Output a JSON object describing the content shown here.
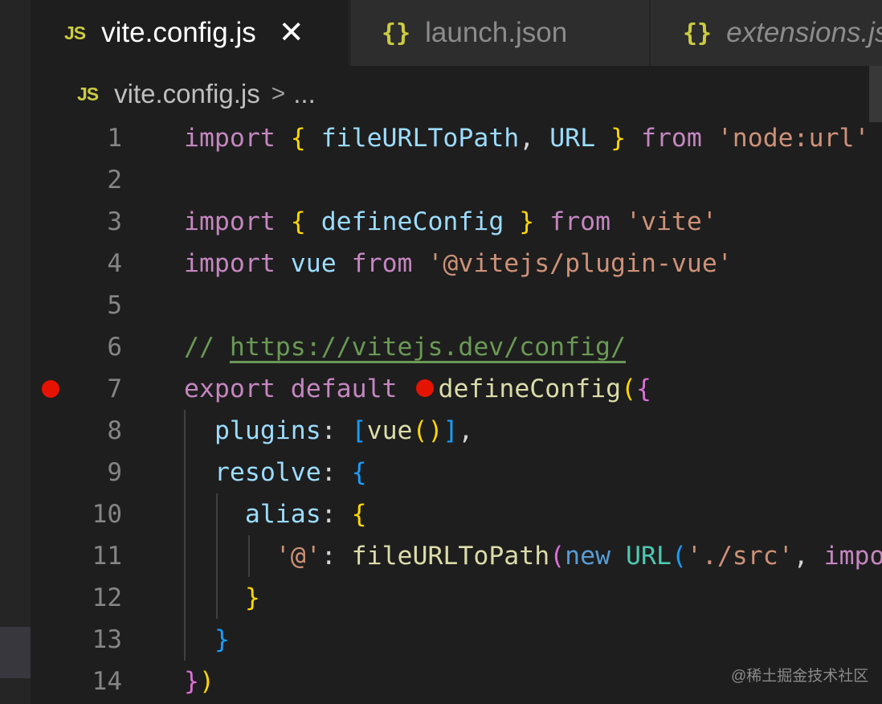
{
  "tabs": [
    {
      "badge": "JS",
      "label": "vite.config.js",
      "close": "✕"
    },
    {
      "badge": "{}",
      "label": "launch.json"
    },
    {
      "badge": "{}",
      "label": "extensions.json"
    }
  ],
  "breadcrumb": {
    "badge": "JS",
    "file": "vite.config.js",
    "separator": ">",
    "more": "..."
  },
  "breakpoint_color": "#e51400",
  "lines": [
    {
      "n": "1",
      "tokens": [
        {
          "t": "import",
          "c": "kw"
        },
        {
          "t": " ",
          "c": "p"
        },
        {
          "t": "{",
          "c": "b1"
        },
        {
          "t": " ",
          "c": "p"
        },
        {
          "t": "fileURLToPath",
          "c": "var"
        },
        {
          "t": ", ",
          "c": "p"
        },
        {
          "t": "URL",
          "c": "var"
        },
        {
          "t": " ",
          "c": "p"
        },
        {
          "t": "}",
          "c": "b1"
        },
        {
          "t": " ",
          "c": "p"
        },
        {
          "t": "from",
          "c": "kw"
        },
        {
          "t": " ",
          "c": "p"
        },
        {
          "t": "'node:url'",
          "c": "str"
        }
      ]
    },
    {
      "n": "2",
      "tokens": []
    },
    {
      "n": "3",
      "tokens": [
        {
          "t": "import",
          "c": "kw"
        },
        {
          "t": " ",
          "c": "p"
        },
        {
          "t": "{",
          "c": "b1"
        },
        {
          "t": " ",
          "c": "p"
        },
        {
          "t": "defineConfig",
          "c": "var"
        },
        {
          "t": " ",
          "c": "p"
        },
        {
          "t": "}",
          "c": "b1"
        },
        {
          "t": " ",
          "c": "p"
        },
        {
          "t": "from",
          "c": "kw"
        },
        {
          "t": " ",
          "c": "p"
        },
        {
          "t": "'vite'",
          "c": "str"
        }
      ]
    },
    {
      "n": "4",
      "tokens": [
        {
          "t": "import",
          "c": "kw"
        },
        {
          "t": " ",
          "c": "p"
        },
        {
          "t": "vue",
          "c": "var"
        },
        {
          "t": " ",
          "c": "p"
        },
        {
          "t": "from",
          "c": "kw"
        },
        {
          "t": " ",
          "c": "p"
        },
        {
          "t": "'@vitejs/plugin-vue'",
          "c": "str"
        }
      ]
    },
    {
      "n": "5",
      "tokens": []
    },
    {
      "n": "6",
      "tokens": [
        {
          "t": "// ",
          "c": "cm"
        },
        {
          "t": "https://vitejs.dev/config/",
          "c": "link"
        }
      ]
    },
    {
      "n": "7",
      "breakpoint": true,
      "tokens": [
        {
          "t": "export",
          "c": "kw"
        },
        {
          "t": " ",
          "c": "p"
        },
        {
          "t": "default",
          "c": "kw"
        },
        {
          "t": " ",
          "c": "p"
        },
        {
          "t": "",
          "c": "bp"
        },
        {
          "t": "defineConfig",
          "c": "fn"
        },
        {
          "t": "(",
          "c": "b1"
        },
        {
          "t": "{",
          "c": "b2"
        }
      ]
    },
    {
      "n": "8",
      "tokens": [
        {
          "t": "  ",
          "c": "p"
        },
        {
          "t": "plugins",
          "c": "var"
        },
        {
          "t": ": ",
          "c": "p"
        },
        {
          "t": "[",
          "c": "b3"
        },
        {
          "t": "vue",
          "c": "fn"
        },
        {
          "t": "()",
          "c": "b1"
        },
        {
          "t": "]",
          "c": "b3"
        },
        {
          "t": ",",
          "c": "p"
        }
      ]
    },
    {
      "n": "9",
      "tokens": [
        {
          "t": "  ",
          "c": "p"
        },
        {
          "t": "resolve",
          "c": "var"
        },
        {
          "t": ": ",
          "c": "p"
        },
        {
          "t": "{",
          "c": "b3"
        }
      ]
    },
    {
      "n": "10",
      "tokens": [
        {
          "t": "    ",
          "c": "p"
        },
        {
          "t": "alias",
          "c": "var"
        },
        {
          "t": ": ",
          "c": "p"
        },
        {
          "t": "{",
          "c": "b1"
        }
      ]
    },
    {
      "n": "11",
      "tokens": [
        {
          "t": "      ",
          "c": "p"
        },
        {
          "t": "'@'",
          "c": "str"
        },
        {
          "t": ": ",
          "c": "p"
        },
        {
          "t": "fileURLToPath",
          "c": "fn"
        },
        {
          "t": "(",
          "c": "b2"
        },
        {
          "t": "new",
          "c": "nw"
        },
        {
          "t": " ",
          "c": "p"
        },
        {
          "t": "URL",
          "c": "cls"
        },
        {
          "t": "(",
          "c": "b3"
        },
        {
          "t": "'./src'",
          "c": "str"
        },
        {
          "t": ", ",
          "c": "p"
        },
        {
          "t": "import",
          "c": "kw"
        }
      ]
    },
    {
      "n": "12",
      "tokens": [
        {
          "t": "    ",
          "c": "p"
        },
        {
          "t": "}",
          "c": "b1"
        }
      ]
    },
    {
      "n": "13",
      "tokens": [
        {
          "t": "  ",
          "c": "p"
        },
        {
          "t": "}",
          "c": "b3"
        }
      ]
    },
    {
      "n": "14",
      "tokens": [
        {
          "t": "}",
          "c": "b2"
        },
        {
          "t": ")",
          "c": "b1"
        }
      ]
    }
  ],
  "watermark": "@稀土掘金技术社区"
}
